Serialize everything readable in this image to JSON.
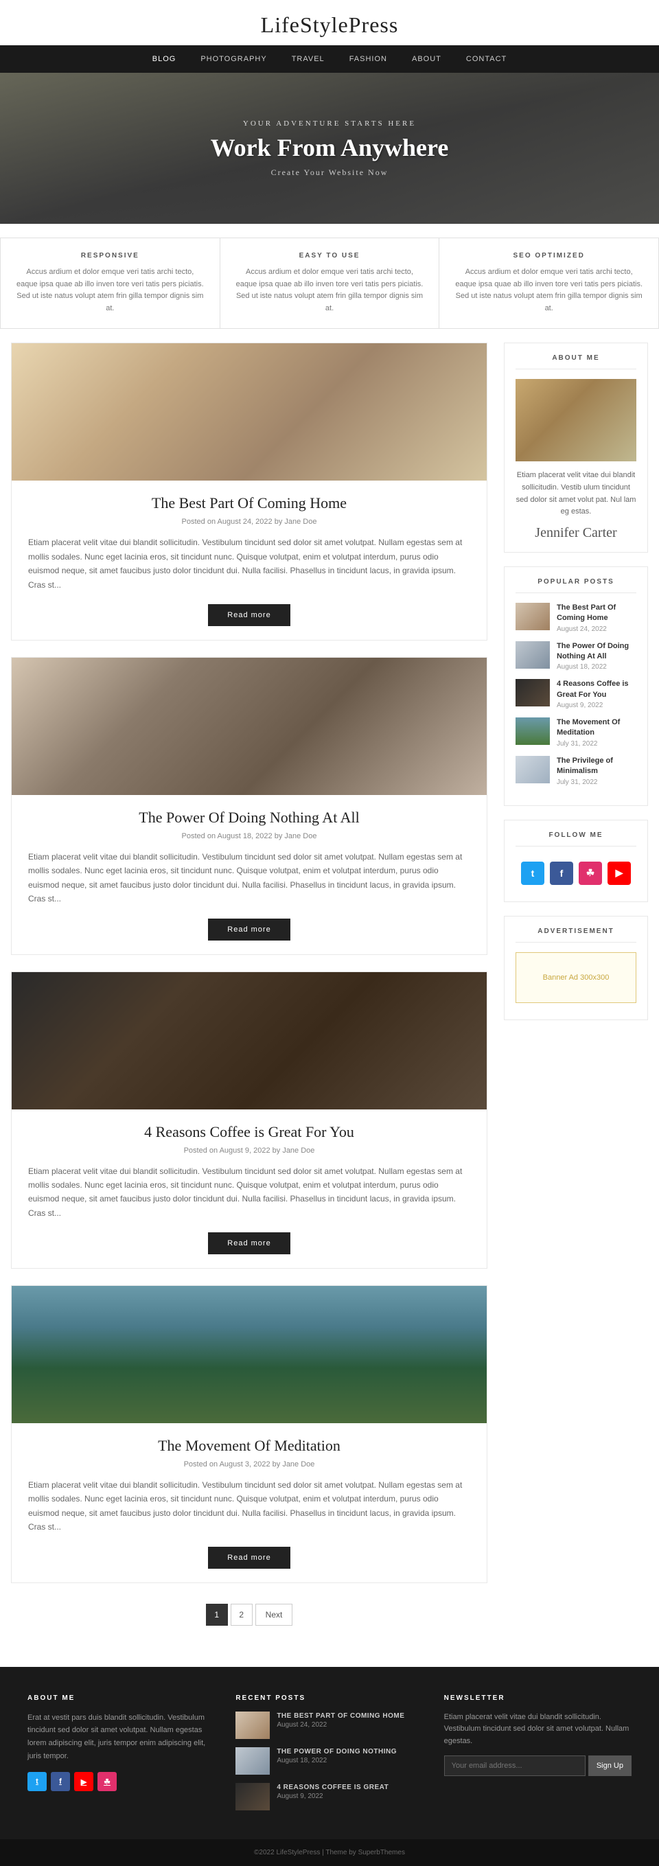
{
  "site": {
    "title": "LifeStylePress"
  },
  "nav": {
    "items": [
      {
        "label": "BLOG",
        "active": true
      },
      {
        "label": "PHOTOGRAPHY",
        "active": false
      },
      {
        "label": "TRAVEL",
        "active": false
      },
      {
        "label": "FASHION",
        "active": false
      },
      {
        "label": "ABOUT",
        "active": false
      },
      {
        "label": "CONTACT",
        "active": false
      }
    ]
  },
  "hero": {
    "subtitle": "Your Adventure Starts Here",
    "title": "Work From Anywhere",
    "tagline": "Create Your Website Now"
  },
  "features": [
    {
      "title": "RESPONSIVE",
      "text": "Accus ardium et dolor emque veri tatis archi tecto, eaque ipsa quae ab illo inven tore veri tatis pers piciatis. Sed ut iste natus volupt atem frin gilla tempor dignis sim at."
    },
    {
      "title": "EASY TO USE",
      "text": "Accus ardium et dolor emque veri tatis archi tecto, eaque ipsa quae ab illo inven tore veri tatis pers piciatis. Sed ut iste natus volupt atem frin gilla tempor dignis sim at."
    },
    {
      "title": "SEO OPTIMIZED",
      "text": "Accus ardium et dolor emque veri tatis archi tecto, eaque ipsa quae ab illo inven tore veri tatis pers piciatis. Sed ut iste natus volupt atem frin gilla tempor dignis sim at."
    }
  ],
  "posts": [
    {
      "title": "The Best Part Of Coming Home",
      "meta": "Posted on August 24, 2022 by Jane Doe",
      "excerpt": "Etiam placerat velit vitae dui blandit sollicitudin. Vestibulum tincidunt sed dolor sit amet volutpat. Nullam egestas sem at mollis sodales. Nunc eget lacinia eros, sit tincidunt nunc. Quisque volutpat, enim et volutpat interdum, purus odio euismod neque, sit amet faucibus justo dolor tincidunt dui. Nulla facilisi. Phasellus in tincidunt lacus, in gravida ipsum. Cras st...",
      "read_more": "Read more",
      "img_class": "img-bedroom"
    },
    {
      "title": "The Power Of Doing Nothing At All",
      "meta": "Posted on August 18, 2022 by Jane Doe",
      "excerpt": "Etiam placerat velit vitae dui blandit sollicitudin. Vestibulum tincidunt sed dolor sit amet volutpat. Nullam egestas sem at mollis sodales. Nunc eget lacinia eros, sit tincidunt nunc. Quisque volutpat, enim et volutpat interdum, purus odio euismod neque, sit amet faucibus justo dolor tincidunt dui. Nulla facilisi. Phasellus in tincidunt lacus, in gravida ipsum. Cras st...",
      "read_more": "Read more",
      "img_class": "img-cafe-work"
    },
    {
      "title": "4 Reasons Coffee is Great For You",
      "meta": "Posted on August 9, 2022 by Jane Doe",
      "excerpt": "Etiam placerat velit vitae dui blandit sollicitudin. Vestibulum tincidunt sed dolor sit amet volutpat. Nullam egestas sem at mollis sodales. Nunc eget lacinia eros, sit tincidunt nunc. Quisque volutpat, enim et volutpat interdum, purus odio euismod neque, sit amet faucibus justo dolor tincidunt dui. Nulla facilisi. Phasellus in tincidunt lacus, in gravida ipsum. Cras st...",
      "read_more": "Read more",
      "img_class": "img-coffee"
    },
    {
      "title": "The Movement Of Meditation",
      "meta": "Posted on August 3, 2022 by Jane Doe",
      "excerpt": "Etiam placerat velit vitae dui blandit sollicitudin. Vestibulum tincidunt sed dolor sit amet volutpat. Nullam egestas sem at mollis sodales. Nunc eget lacinia eros, sit tincidunt nunc. Quisque volutpat, enim et volutpat interdum, purus odio euismod neque, sit amet faucibus justo dolor tincidunt dui. Nulla facilisi. Phasellus in tincidunt lacus, in gravida ipsum. Cras st...",
      "read_more": "Read more",
      "img_class": "img-mountain"
    }
  ],
  "sidebar": {
    "about": {
      "title": "ABOUT ME",
      "text": "Etiam placerat velit vitae dui blandit sollicitudin. Vestib ulum tincidunt sed dolor sit amet volut pat. Nul lam eg estas.",
      "signature": "Jennifer Carter"
    },
    "popular_posts": {
      "title": "POPULAR POSTS",
      "items": [
        {
          "title": "The Best Part Of Coming Home",
          "date": "August 24, 2022",
          "img_class": "img-pop1"
        },
        {
          "title": "The Power Of Doing Nothing At All",
          "date": "August 18, 2022",
          "img_class": "img-pop2"
        },
        {
          "title": "4 Reasons Coffee is Great For You",
          "date": "August 9, 2022",
          "img_class": "img-pop3"
        },
        {
          "title": "The Movement Of Meditation",
          "date": "July 31, 2022",
          "img_class": "img-pop4"
        },
        {
          "title": "The Privilege of Minimalism",
          "date": "July 31, 2022",
          "img_class": "img-pop5"
        }
      ]
    },
    "follow": {
      "title": "FOLLOW ME"
    },
    "advertisement": {
      "title": "ADVERTISEMENT",
      "text": "Banner Ad 300x300"
    }
  },
  "pagination": {
    "pages": [
      "1",
      "2"
    ],
    "next_label": "Next"
  },
  "footer": {
    "about": {
      "title": "ABOUT ME",
      "text": "Erat at vestit pars duis blandit sollicitudin. Vestibulum tincidunt sed dolor sit amet volutpat. Nullam egestas lorem adipiscing elit, juris tempor enim adipiscing elit, juris tempor."
    },
    "recent_posts": {
      "title": "RECENT POSTS",
      "items": [
        {
          "title": "THE BEST PART OF COMING HOME",
          "date": "August 24, 2022",
          "img_class": "img-pop1"
        },
        {
          "title": "THE POWER OF DOING NOTHING",
          "date": "August 18, 2022",
          "img_class": "img-pop2"
        },
        {
          "title": "4 REASONS COFFEE IS GREAT",
          "date": "August 9, 2022",
          "img_class": "img-pop3"
        }
      ]
    },
    "newsletter": {
      "title": "NEWSLETTER",
      "text": "Etiam placerat velit vitae dui blandit sollicitudin. Vestibulum tincidunt sed dolor sit amet volutpat. Nullam egestas.",
      "placeholder": "Your email address...",
      "button_label": "Sign Up"
    },
    "bottom": {
      "text": "©2022 LifeStylePress | Theme by SuperbThemes"
    }
  }
}
